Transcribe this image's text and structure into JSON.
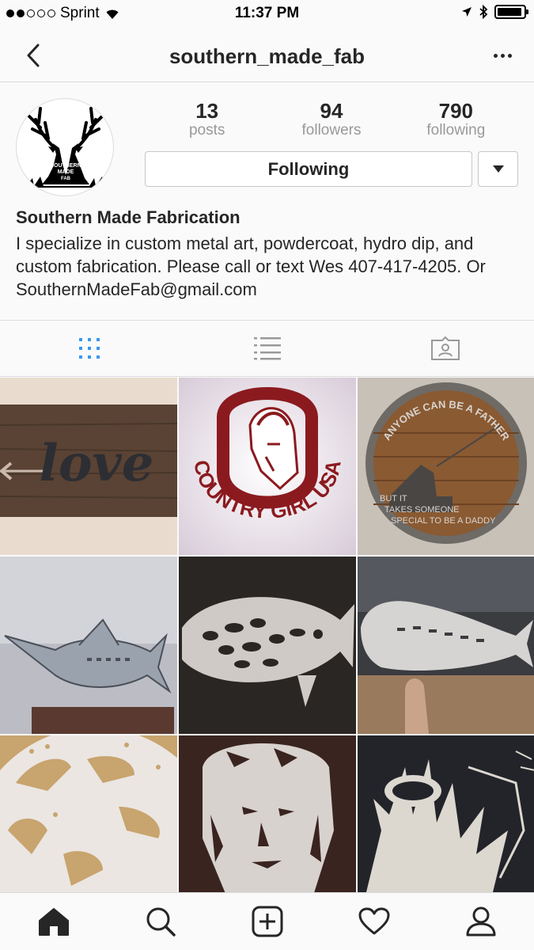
{
  "status_bar": {
    "carrier": "Sprint",
    "time": "11:37 PM",
    "signal_dots_filled": 2,
    "signal_dots_total": 5
  },
  "nav": {
    "title": "southern_made_fab",
    "back_icon": "chevron-left-icon",
    "more_icon": "more-horizontal-icon"
  },
  "profile": {
    "avatar_text": [
      "SOUTHERN",
      "MADE",
      "FAB"
    ],
    "stats": [
      {
        "value": "13",
        "label": "posts"
      },
      {
        "value": "94",
        "label": "followers"
      },
      {
        "value": "790",
        "label": "following"
      }
    ],
    "following_button_label": "Following",
    "name": "Southern Made Fabrication",
    "bio": "I specialize in custom metal art, powdercoat, hydro dip, and custom fabrication. Please call or text Wes 407-417-4205. Or SouthernMadeFab@gmail.com"
  },
  "tabs": [
    {
      "name": "grid-view",
      "icon": "grid-icon",
      "active": true
    },
    {
      "name": "list-view",
      "icon": "list-icon",
      "active": false
    },
    {
      "name": "tagged",
      "icon": "tagged-person-icon",
      "active": false
    }
  ],
  "posts": [
    {
      "text": "love"
    },
    {
      "text": "COUNTRY GIRL USA"
    },
    {
      "text_top": "ANYONE CAN BE A FATHER",
      "text_lines": [
        "BUT IT",
        "TAKES SOMEONE",
        "SPECIAL TO BE A DADDY"
      ]
    },
    {
      "text": ""
    },
    {
      "text": ""
    },
    {
      "text": ""
    },
    {
      "text": ""
    },
    {
      "text": ""
    },
    {
      "text": ""
    }
  ],
  "bottom_nav": [
    {
      "name": "home",
      "icon": "home-icon"
    },
    {
      "name": "search",
      "icon": "search-icon"
    },
    {
      "name": "new-post",
      "icon": "add-post-icon"
    },
    {
      "name": "activity",
      "icon": "heart-icon"
    },
    {
      "name": "profile",
      "icon": "profile-icon"
    }
  ],
  "colors": {
    "accent_blue": "#3897f0",
    "text_primary": "#262626",
    "text_secondary": "#999999",
    "border": "#dbdbdb"
  }
}
